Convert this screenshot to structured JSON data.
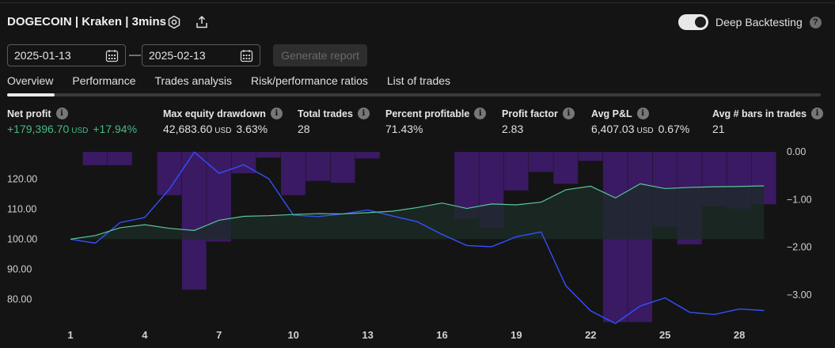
{
  "header": {
    "title": "DOGECOIN | Kraken | 3mins",
    "deep_backtesting_label": "Deep Backtesting",
    "help_glyph": "?"
  },
  "date_range": {
    "start": "2025-01-13",
    "separator": "—",
    "end": "2025-02-13",
    "generate_label": "Generate report"
  },
  "tabs": [
    {
      "label": "Overview"
    },
    {
      "label": "Performance"
    },
    {
      "label": "Trades analysis"
    },
    {
      "label": "Risk/performance ratios"
    },
    {
      "label": "List of trades"
    }
  ],
  "metrics": [
    {
      "label": "Net profit",
      "value": "+179,396.70",
      "unit": "USD",
      "pct": "+17.94%"
    },
    {
      "label": "Max equity drawdown",
      "value": "42,683.60",
      "unit": "USD",
      "pct": "3.63%"
    },
    {
      "label": "Total trades",
      "value": "28"
    },
    {
      "label": "Percent profitable",
      "value": "71.43%"
    },
    {
      "label": "Profit factor",
      "value": "2.83"
    },
    {
      "label": "Avg P&L",
      "value": "6,407.03",
      "unit": "USD",
      "pct": "0.67%"
    },
    {
      "label": "Avg # bars in trades",
      "value": "21"
    }
  ],
  "info_glyph": "i",
  "colors": {
    "accent_green": "#46b885",
    "equity_line": "#57c796",
    "buy_hold_line": "#3350ff",
    "drawdown_bar": "#3a1a63",
    "equity_fill": "#1c2c26"
  },
  "chart_data": {
    "type": "line",
    "x_ticks": [
      "1",
      "4",
      "7",
      "10",
      "13",
      "16",
      "19",
      "22",
      "25",
      "28"
    ],
    "left_axis": {
      "ticks": [
        "120.00",
        "110.00",
        "100.00",
        "90.00",
        "80.00"
      ],
      "range": [
        72,
        129
      ]
    },
    "right_axis": {
      "ticks": [
        "0.00",
        "−1.00",
        "−2.00",
        "−3.00"
      ],
      "range": [
        -3.6,
        0
      ]
    },
    "trades": [
      1,
      2,
      3,
      4,
      5,
      6,
      7,
      8,
      9,
      10,
      11,
      12,
      13,
      14,
      15,
      16,
      17,
      18,
      19,
      20,
      21,
      22,
      23,
      24,
      25,
      26,
      27,
      28,
      29
    ],
    "series": [
      {
        "values": [
          100.0,
          101.2,
          103.8,
          104.8,
          103.6,
          102.9,
          106.3,
          107.6,
          107.8,
          108.2,
          108.5,
          108.4,
          108.8,
          109.3,
          110.5,
          112.0,
          110.2,
          111.7,
          111.4,
          112.3,
          116.4,
          117.6,
          113.7,
          118.4,
          116.8,
          117.2,
          117.4,
          117.5,
          117.7
        ]
      },
      {
        "values": [
          100.0,
          98.7,
          105.5,
          107.2,
          116.7,
          128.9,
          121.9,
          124.7,
          120.1,
          108.0,
          107.5,
          108.4,
          109.7,
          107.7,
          105.8,
          101.6,
          97.9,
          97.5,
          100.8,
          102.4,
          84.5,
          76.2,
          72.0,
          77.8,
          80.5,
          75.7,
          75.0,
          76.8,
          76.3
        ]
      },
      {
        "values": [
          0,
          -0.28,
          -0.28,
          0,
          -0.91,
          -2.89,
          -1.88,
          -0.45,
          -0.12,
          -0.91,
          -0.61,
          -0.65,
          -0.14,
          0,
          0,
          0,
          -1.4,
          -1.6,
          -0.81,
          -0.42,
          -0.67,
          -0.19,
          -3.57,
          -3.57,
          -1.57,
          -1.94,
          -1.14,
          -1.19,
          -1.1
        ]
      }
    ]
  }
}
